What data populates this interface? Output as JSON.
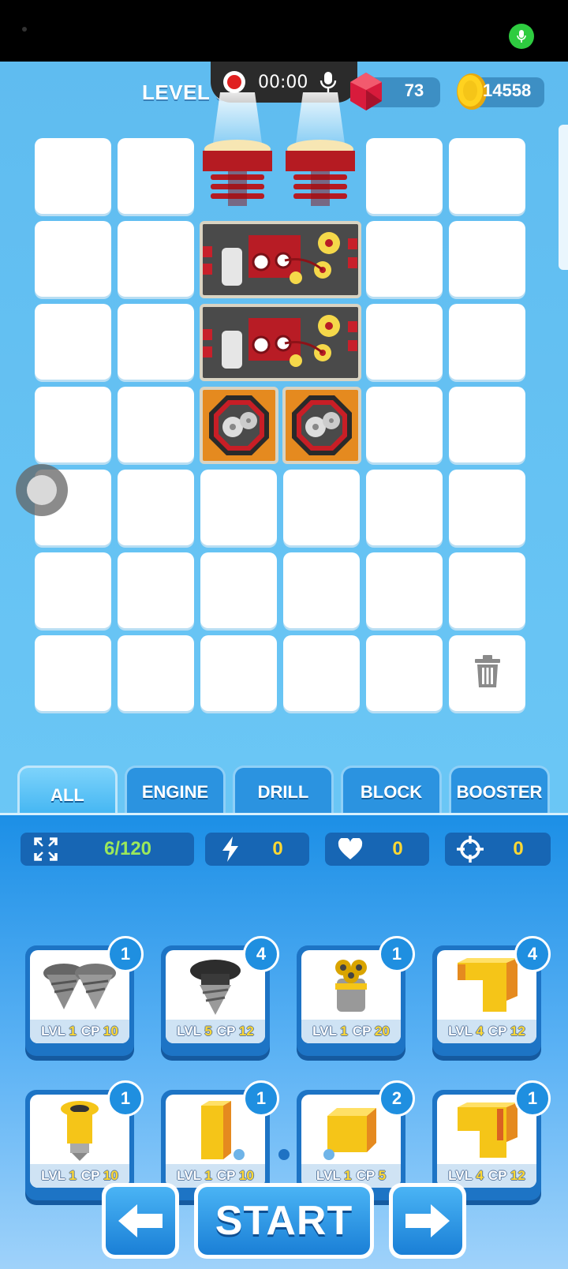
{
  "hud": {
    "level_label": "LEVEL 57",
    "recorder_time": "00:00",
    "gems": "73",
    "coins": "14558"
  },
  "grid": {
    "rows": 7,
    "cols": 6,
    "parts": [
      {
        "kind": "drill",
        "row": 0,
        "col": 2
      },
      {
        "kind": "drill",
        "row": 0,
        "col": 3
      },
      {
        "kind": "engine",
        "row": 1,
        "col": 2,
        "span": 2
      },
      {
        "kind": "engine",
        "row": 2,
        "col": 2,
        "span": 2
      },
      {
        "kind": "cog",
        "row": 3,
        "col": 2
      },
      {
        "kind": "cog",
        "row": 3,
        "col": 3
      }
    ],
    "trash_cell": {
      "row": 6,
      "col": 5
    }
  },
  "tabs": [
    {
      "label": "ALL",
      "active": true
    },
    {
      "label": "ENGINE",
      "active": false
    },
    {
      "label": "DRILL",
      "active": false
    },
    {
      "label": "BLOCK",
      "active": false
    },
    {
      "label": "BOOSTER",
      "active": false
    }
  ],
  "stats": {
    "capacity": "6/120",
    "power": "0",
    "health": "0",
    "accuracy": "0"
  },
  "cards": [
    {
      "count": "1",
      "lvl": "1",
      "cp": "10",
      "icon": "twin-drill"
    },
    {
      "count": "4",
      "lvl": "5",
      "cp": "12",
      "icon": "dark-drill"
    },
    {
      "count": "1",
      "lvl": "1",
      "cp": "20",
      "icon": "triple-drill"
    },
    {
      "count": "4",
      "lvl": "4",
      "cp": "12",
      "icon": "yellow-corner-block"
    },
    {
      "count": "1",
      "lvl": "1",
      "cp": "10",
      "icon": "yellow-drill"
    },
    {
      "count": "1",
      "lvl": "1",
      "cp": "10",
      "icon": "yellow-tall-block"
    },
    {
      "count": "2",
      "lvl": "1",
      "cp": "5",
      "icon": "yellow-cube-block"
    },
    {
      "count": "1",
      "lvl": "4",
      "cp": "12",
      "icon": "yellow-l-block"
    }
  ],
  "labels": {
    "lvl": "LVL",
    "cp": "CP"
  },
  "pager": {
    "pages": 3,
    "current": 2
  },
  "buttons": {
    "start": "START"
  },
  "colors": {
    "accent": "#2b93e0",
    "gem": "#e02040",
    "coin": "#f5c518"
  }
}
